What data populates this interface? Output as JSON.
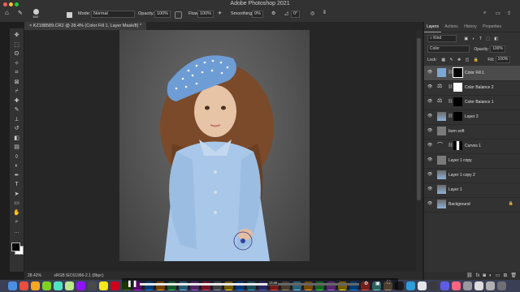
{
  "window": {
    "title": "Adobe Photoshop 2021"
  },
  "options_bar": {
    "mode_label": "Mode:",
    "mode_value": "Normal",
    "opacity_label": "Opacity:",
    "opacity_value": "100%",
    "flow_label": "Flow:",
    "flow_value": "100%",
    "smoothing_label": "Smoothing:",
    "smoothing_value": "0%",
    "angle_value": "0°",
    "brush_size": "600"
  },
  "document": {
    "tab_label": "KZ188589.CR2 @ 28.4% (Color Fill 1, Layer Mask/8) *",
    "status_zoom": "28.42%",
    "status_profile": "sRGB IEC61966-2.1 (8bpc)"
  },
  "panel": {
    "tabs": [
      "Layers",
      "Actions",
      "History",
      "Properties"
    ],
    "active_tab": "Layers",
    "filter_kind": "Kind",
    "blend_mode": "Color",
    "opacity_label": "Opacity:",
    "opacity_value": "100%",
    "lock_label": "Lock:",
    "fill_label": "Fill:",
    "fill_value": "100%",
    "layers": [
      {
        "name": "Color Fill 1",
        "kind": "fill",
        "selected": true
      },
      {
        "name": "Color Balance 2",
        "kind": "adjustment",
        "selected": false
      },
      {
        "name": "Color Balance 1",
        "kind": "adjustment",
        "selected": false
      },
      {
        "name": "Layer 2",
        "kind": "pixel-mask",
        "selected": false
      },
      {
        "name": "burn soft",
        "kind": "gray",
        "selected": false
      },
      {
        "name": "Curves 1",
        "kind": "curves",
        "selected": false
      },
      {
        "name": "Layer 1 copy",
        "kind": "gray",
        "selected": false
      },
      {
        "name": "Layer 1 copy 2",
        "kind": "photo",
        "selected": false
      },
      {
        "name": "Layer 1",
        "kind": "photo",
        "selected": false
      },
      {
        "name": "Background",
        "kind": "photo-locked",
        "selected": false
      }
    ],
    "bottom_icons": [
      "link-icon",
      "fx-icon",
      "mask-icon",
      "adjustment-icon",
      "folder-icon",
      "new-layer-icon",
      "trash-icon"
    ]
  },
  "tools": [
    "move-icon",
    "marquee-icon",
    "lasso-icon",
    "quick-select-icon",
    "crop-icon",
    "frame-icon",
    "eyedropper-icon",
    "healing-icon",
    "brush-icon",
    "stamp-icon",
    "history-brush-icon",
    "eraser-icon",
    "gradient-icon",
    "blur-icon",
    "dodge-icon",
    "pen-icon",
    "type-icon",
    "path-select-icon",
    "rectangle-icon",
    "hand-icon",
    "zoom-icon",
    "more-icon"
  ],
  "video": {
    "time": "13:48",
    "progress": 0.58,
    "state": "paused"
  },
  "colors": {
    "fill_swatch": "#7aa7d6",
    "coat": "#a9c7e8",
    "beret": "#6e9dd6",
    "hair": "#7a4a2a"
  }
}
